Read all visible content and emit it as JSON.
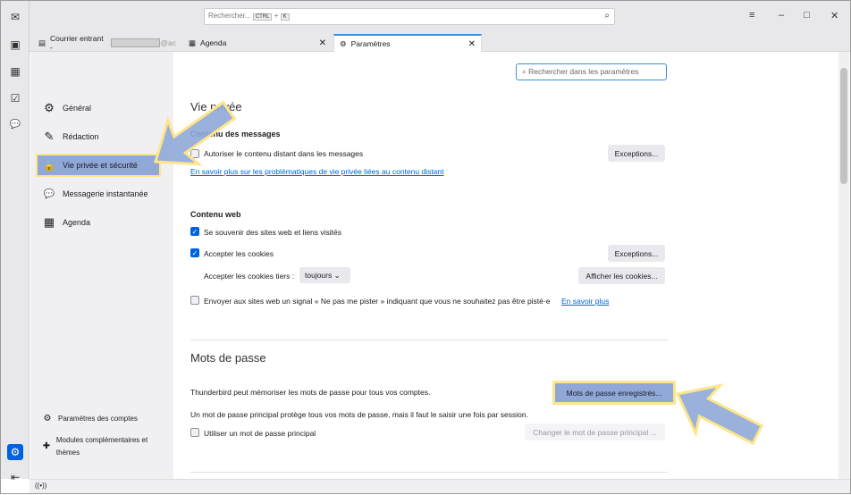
{
  "spaces": [
    {
      "icon": "mail-icon",
      "glyph": "✉"
    },
    {
      "icon": "address-book-icon",
      "glyph": "▣"
    },
    {
      "icon": "calendar-icon",
      "glyph": "▦"
    },
    {
      "icon": "tasks-icon",
      "glyph": "☑"
    },
    {
      "icon": "chat-icon",
      "glyph": "💬"
    }
  ],
  "topbar": {
    "search_placeholder": "Rechercher...",
    "kbd_ctrl": "CTRL",
    "plus": "+",
    "kbd_k": "K",
    "menu": "≡",
    "minimize": "–",
    "maximize": "□",
    "close": "✕"
  },
  "tabs": [
    {
      "label": "Courrier entrant -",
      "suffix": "@ac",
      "icon": "inbox-icon"
    },
    {
      "label": "Agenda",
      "icon": "calendar-icon"
    },
    {
      "label": "Paramètres",
      "icon": "gear-icon"
    }
  ],
  "sidebar": {
    "items": [
      {
        "label": "Général",
        "glyph": "⚙"
      },
      {
        "label": "Rédaction",
        "glyph": "✎"
      },
      {
        "label": "Vie privée et sécurité",
        "glyph": "🔒"
      },
      {
        "label": "Messagerie instantanée",
        "glyph": "💬"
      },
      {
        "label": "Agenda",
        "glyph": "▦"
      }
    ],
    "bottom": [
      {
        "label": "Paramètres des comptes",
        "glyph": "⚙"
      },
      {
        "label": "Modules complémentaires et thèmes",
        "glyph": "✚"
      }
    ]
  },
  "main": {
    "search_placeholder": "Rechercher dans les paramètres",
    "privacy_title": "Vie privée",
    "messages_title": "Contenu des messages",
    "allow_remote": "Autoriser le contenu distant dans les messages",
    "exceptions": "Exceptions...",
    "learn_remote": "En savoir plus sur les problématiques de vie privée liées au contenu distant",
    "web_title": "Contenu web",
    "remember_sites": "Se souvenir des sites web et liens visités",
    "accept_cookies": "Accepter les cookies",
    "third_party_label": "Accepter les cookies tiers :",
    "third_party_value": "toujours",
    "show_cookies": "Afficher les cookies...",
    "dnt": "Envoyer aux sites web un signal « Ne pas me pister » indiquant que vous ne souhaitez pas être pisté·e",
    "learn_more": "En savoir plus",
    "passwords_title": "Mots de passe",
    "passwords_text": "Thunderbird peut mémoriser les mots de passe pour tous vos comptes.",
    "saved_passwords": "Mots de passe enregistrés...",
    "primary_text": "Un mot de passe principal protège tous vos mots de passe, mais il faut le saisir une fois par session.",
    "use_primary": "Utiliser un mot de passe principal",
    "change_primary": "Changer le mot de passe principal ..."
  },
  "status": {
    "icon": "wifi-icon",
    "glyph": "((•))"
  },
  "colors": {
    "accent": "#0061e0",
    "highlight_fill": "#8fa8d8",
    "highlight_border": "#fde58a"
  }
}
